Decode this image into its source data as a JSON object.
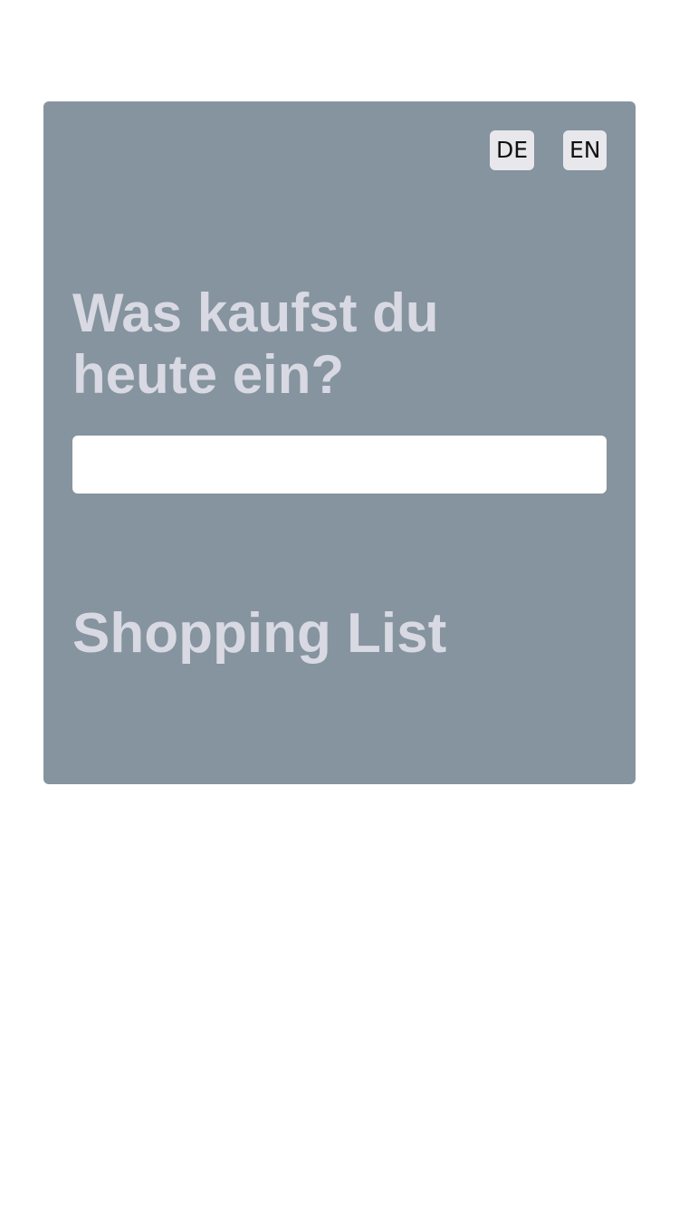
{
  "language_switcher": {
    "de_label": "DE",
    "en_label": "EN"
  },
  "prompt": {
    "heading": "Was kaufst du heute ein?",
    "input_value": "",
    "input_placeholder": ""
  },
  "list": {
    "title": "Shopping List"
  },
  "colors": {
    "card": "#85949f",
    "heading": "#d8d9e3",
    "button": "#e8e8ec"
  }
}
